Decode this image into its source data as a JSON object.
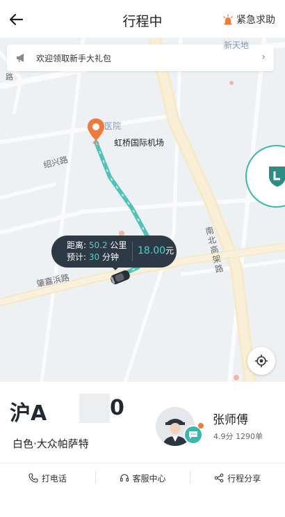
{
  "header": {
    "title": "行程中",
    "back_icon": "back-arrow-icon",
    "emergency_label": "紧急求助",
    "emergency_icon": "alarm-light-icon",
    "emergency_color": "#f07a3a"
  },
  "map": {
    "promo_banner": {
      "text": "欢迎领取新手大礼包",
      "icon": "megaphone-icon"
    },
    "labels": {
      "destination": "虹桥国际机场",
      "hospital_partial": "医院",
      "road_shaoxing": "绍兴路",
      "road_zhaojiabang": "肇嘉浜路",
      "road_nanbei": "南北高架路",
      "top_right": "新天地",
      "top_left_partial": "路"
    },
    "trip_info": {
      "distance_label": "距离:",
      "distance_value": "50.2",
      "distance_unit": "公里",
      "eta_label": "预计:",
      "eta_value": "30",
      "eta_unit": "分钟",
      "price_value": "18.00",
      "price_unit": "元"
    },
    "route_color": "#4ec4b9",
    "accent_color": "#3bb7ad"
  },
  "trip_panel": {
    "plate_prefix": "沪A",
    "plate_suffix": "0",
    "car_description": "白色·大众帕萨特",
    "driver_name": "张师傅",
    "driver_rating": "4.9分 1290单"
  },
  "actions": [
    {
      "label": "打电话",
      "icon": "phone-icon"
    },
    {
      "label": "客服中心",
      "icon": "headset-icon"
    },
    {
      "label": "行程分享",
      "icon": "share-icon"
    }
  ]
}
